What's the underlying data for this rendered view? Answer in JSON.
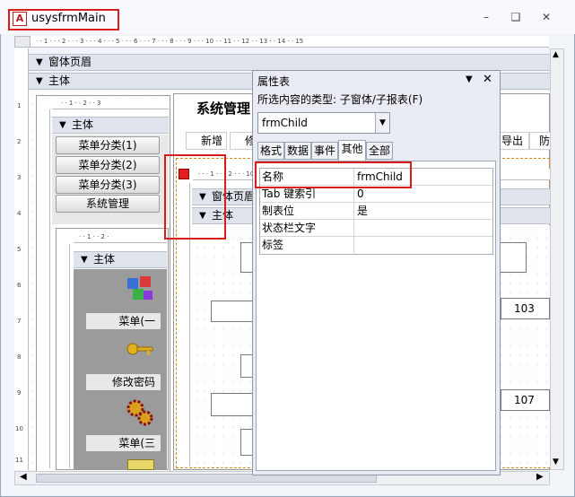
{
  "window": {
    "title": "usysfrmMain",
    "app_icon": "access-icon"
  },
  "ruler_top": "· · 1 · · · 2 · · · 3 · · · 4 · · · 5 · · · 6 · · · 7 · · · 8 · · · 9 · · · 10 · · 11 · · 12 · · 13 · · 14 · · 15",
  "sections": {
    "header": "窗体页眉",
    "detail": "主体"
  },
  "sub_form": {
    "ruler": "· · 1 · · 2 · · 3",
    "detail": "主体",
    "menu_buttons": [
      "菜单分类(1)",
      "菜单分类(2)",
      "菜单分类(3)",
      "系统管理"
    ],
    "inner_ruler": "· · 1 · · 2 ·",
    "inner_detail": "主体",
    "icon_labels": [
      "菜单(一",
      "修改密码",
      "菜单(三"
    ]
  },
  "main_panel": {
    "title": "系统管理",
    "toolbar": {
      "new": "新增",
      "modify": "修",
      "export": "导出",
      "print": "防"
    },
    "child_ruler": "· · · 1 · · · 2 · · · 10 ·",
    "child_header": "窗体页眉",
    "child_detail": "主体",
    "values": [
      "103",
      "107"
    ]
  },
  "property_sheet": {
    "title": "属性表",
    "selection_type": "所选内容的类型: 子窗体/子报表(F)",
    "selected_object": "frmChild",
    "tabs": [
      "格式",
      "数据",
      "事件",
      "其他",
      "全部"
    ],
    "active_tab": "其他",
    "rows": [
      {
        "name": "名称",
        "value": "frmChild"
      },
      {
        "name": "Tab 键索引",
        "value": "0"
      },
      {
        "name": "制表位",
        "value": "是"
      },
      {
        "name": "状态栏文字",
        "value": ""
      },
      {
        "name": "标签",
        "value": ""
      }
    ]
  },
  "vertical_ruler_numbers": [
    "1",
    "2",
    "3",
    "4",
    "5",
    "6",
    "7",
    "8",
    "9",
    "10",
    "11"
  ],
  "highlight_color": "#d81d1d"
}
